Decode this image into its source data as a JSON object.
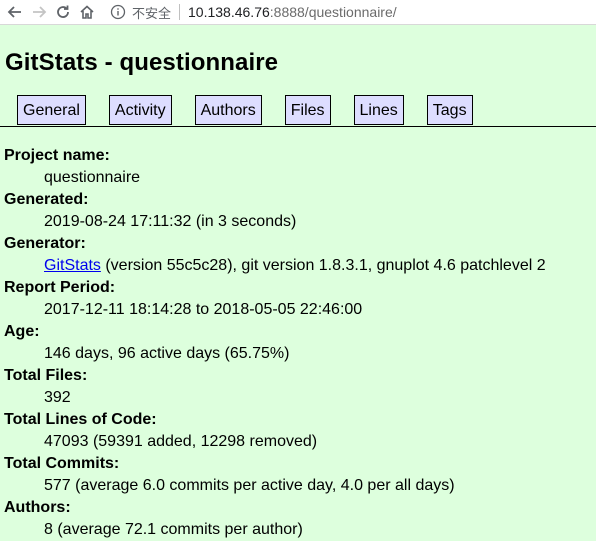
{
  "browser": {
    "security_label": "不安全",
    "url_host": "10.138.46.76",
    "url_rest": ":8888/questionnaire/"
  },
  "page": {
    "title": "GitStats - questionnaire"
  },
  "nav": {
    "tabs": [
      "General",
      "Activity",
      "Authors",
      "Files",
      "Lines",
      "Tags"
    ]
  },
  "info": {
    "project_name_label": "Project name:",
    "project_name": "questionnaire",
    "generated_label": "Generated:",
    "generated": "2019-08-24 17:11:32 (in 3 seconds)",
    "generator_label": "Generator:",
    "generator_link": "GitStats",
    "generator_rest": " (version 55c5c28), git version 1.8.3.1, gnuplot 4.6 patchlevel 2",
    "report_period_label": "Report Period:",
    "report_period": "2017-12-11 18:14:28 to 2018-05-05 22:46:00",
    "age_label": "Age:",
    "age": "146 days, 96 active days (65.75%)",
    "total_files_label": "Total Files:",
    "total_files": "392",
    "total_loc_label": "Total Lines of Code:",
    "total_loc": "47093 (59391 added, 12298 removed)",
    "total_commits_label": "Total Commits:",
    "total_commits": "577 (average 6.0 commits per active day, 4.0 per all days)",
    "authors_label": "Authors:",
    "authors": "8 (average 72.1 commits per author)"
  }
}
